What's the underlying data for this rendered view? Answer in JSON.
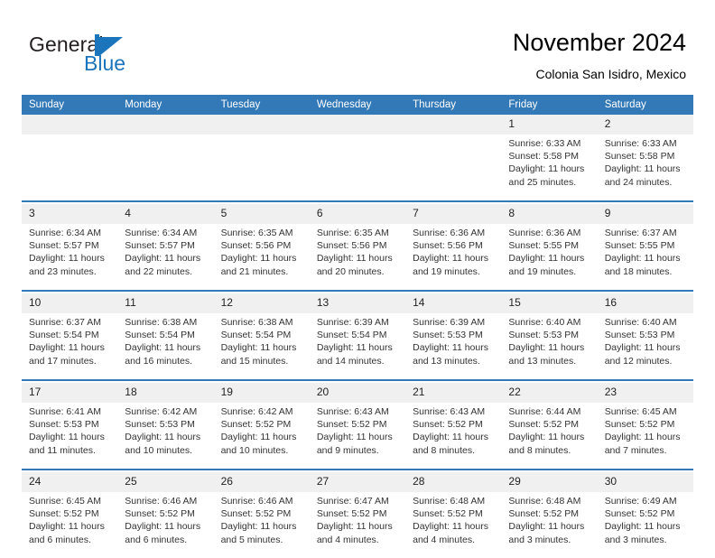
{
  "brand": {
    "word_one": "General",
    "word_two": "Blue",
    "mark": "triangle-logo"
  },
  "header": {
    "title": "November 2024",
    "location": "Colonia San Isidro, Mexico"
  },
  "colors": {
    "header_blue": "#3479b7",
    "brand_blue": "#1b75bc",
    "daynum_band": "#f0f0f0",
    "text": "#333333"
  },
  "weekday_headers": [
    "Sunday",
    "Monday",
    "Tuesday",
    "Wednesday",
    "Thursday",
    "Friday",
    "Saturday"
  ],
  "weeks": [
    [
      {
        "day": "",
        "sunrise": "",
        "sunset": "",
        "daylight_1": "",
        "daylight_2": ""
      },
      {
        "day": "",
        "sunrise": "",
        "sunset": "",
        "daylight_1": "",
        "daylight_2": ""
      },
      {
        "day": "",
        "sunrise": "",
        "sunset": "",
        "daylight_1": "",
        "daylight_2": ""
      },
      {
        "day": "",
        "sunrise": "",
        "sunset": "",
        "daylight_1": "",
        "daylight_2": ""
      },
      {
        "day": "",
        "sunrise": "",
        "sunset": "",
        "daylight_1": "",
        "daylight_2": ""
      },
      {
        "day": "1",
        "sunrise": "Sunrise: 6:33 AM",
        "sunset": "Sunset: 5:58 PM",
        "daylight_1": "Daylight: 11 hours",
        "daylight_2": "and 25 minutes."
      },
      {
        "day": "2",
        "sunrise": "Sunrise: 6:33 AM",
        "sunset": "Sunset: 5:58 PM",
        "daylight_1": "Daylight: 11 hours",
        "daylight_2": "and 24 minutes."
      }
    ],
    [
      {
        "day": "3",
        "sunrise": "Sunrise: 6:34 AM",
        "sunset": "Sunset: 5:57 PM",
        "daylight_1": "Daylight: 11 hours",
        "daylight_2": "and 23 minutes."
      },
      {
        "day": "4",
        "sunrise": "Sunrise: 6:34 AM",
        "sunset": "Sunset: 5:57 PM",
        "daylight_1": "Daylight: 11 hours",
        "daylight_2": "and 22 minutes."
      },
      {
        "day": "5",
        "sunrise": "Sunrise: 6:35 AM",
        "sunset": "Sunset: 5:56 PM",
        "daylight_1": "Daylight: 11 hours",
        "daylight_2": "and 21 minutes."
      },
      {
        "day": "6",
        "sunrise": "Sunrise: 6:35 AM",
        "sunset": "Sunset: 5:56 PM",
        "daylight_1": "Daylight: 11 hours",
        "daylight_2": "and 20 minutes."
      },
      {
        "day": "7",
        "sunrise": "Sunrise: 6:36 AM",
        "sunset": "Sunset: 5:56 PM",
        "daylight_1": "Daylight: 11 hours",
        "daylight_2": "and 19 minutes."
      },
      {
        "day": "8",
        "sunrise": "Sunrise: 6:36 AM",
        "sunset": "Sunset: 5:55 PM",
        "daylight_1": "Daylight: 11 hours",
        "daylight_2": "and 19 minutes."
      },
      {
        "day": "9",
        "sunrise": "Sunrise: 6:37 AM",
        "sunset": "Sunset: 5:55 PM",
        "daylight_1": "Daylight: 11 hours",
        "daylight_2": "and 18 minutes."
      }
    ],
    [
      {
        "day": "10",
        "sunrise": "Sunrise: 6:37 AM",
        "sunset": "Sunset: 5:54 PM",
        "daylight_1": "Daylight: 11 hours",
        "daylight_2": "and 17 minutes."
      },
      {
        "day": "11",
        "sunrise": "Sunrise: 6:38 AM",
        "sunset": "Sunset: 5:54 PM",
        "daylight_1": "Daylight: 11 hours",
        "daylight_2": "and 16 minutes."
      },
      {
        "day": "12",
        "sunrise": "Sunrise: 6:38 AM",
        "sunset": "Sunset: 5:54 PM",
        "daylight_1": "Daylight: 11 hours",
        "daylight_2": "and 15 minutes."
      },
      {
        "day": "13",
        "sunrise": "Sunrise: 6:39 AM",
        "sunset": "Sunset: 5:54 PM",
        "daylight_1": "Daylight: 11 hours",
        "daylight_2": "and 14 minutes."
      },
      {
        "day": "14",
        "sunrise": "Sunrise: 6:39 AM",
        "sunset": "Sunset: 5:53 PM",
        "daylight_1": "Daylight: 11 hours",
        "daylight_2": "and 13 minutes."
      },
      {
        "day": "15",
        "sunrise": "Sunrise: 6:40 AM",
        "sunset": "Sunset: 5:53 PM",
        "daylight_1": "Daylight: 11 hours",
        "daylight_2": "and 13 minutes."
      },
      {
        "day": "16",
        "sunrise": "Sunrise: 6:40 AM",
        "sunset": "Sunset: 5:53 PM",
        "daylight_1": "Daylight: 11 hours",
        "daylight_2": "and 12 minutes."
      }
    ],
    [
      {
        "day": "17",
        "sunrise": "Sunrise: 6:41 AM",
        "sunset": "Sunset: 5:53 PM",
        "daylight_1": "Daylight: 11 hours",
        "daylight_2": "and 11 minutes."
      },
      {
        "day": "18",
        "sunrise": "Sunrise: 6:42 AM",
        "sunset": "Sunset: 5:53 PM",
        "daylight_1": "Daylight: 11 hours",
        "daylight_2": "and 10 minutes."
      },
      {
        "day": "19",
        "sunrise": "Sunrise: 6:42 AM",
        "sunset": "Sunset: 5:52 PM",
        "daylight_1": "Daylight: 11 hours",
        "daylight_2": "and 10 minutes."
      },
      {
        "day": "20",
        "sunrise": "Sunrise: 6:43 AM",
        "sunset": "Sunset: 5:52 PM",
        "daylight_1": "Daylight: 11 hours",
        "daylight_2": "and 9 minutes."
      },
      {
        "day": "21",
        "sunrise": "Sunrise: 6:43 AM",
        "sunset": "Sunset: 5:52 PM",
        "daylight_1": "Daylight: 11 hours",
        "daylight_2": "and 8 minutes."
      },
      {
        "day": "22",
        "sunrise": "Sunrise: 6:44 AM",
        "sunset": "Sunset: 5:52 PM",
        "daylight_1": "Daylight: 11 hours",
        "daylight_2": "and 8 minutes."
      },
      {
        "day": "23",
        "sunrise": "Sunrise: 6:45 AM",
        "sunset": "Sunset: 5:52 PM",
        "daylight_1": "Daylight: 11 hours",
        "daylight_2": "and 7 minutes."
      }
    ],
    [
      {
        "day": "24",
        "sunrise": "Sunrise: 6:45 AM",
        "sunset": "Sunset: 5:52 PM",
        "daylight_1": "Daylight: 11 hours",
        "daylight_2": "and 6 minutes."
      },
      {
        "day": "25",
        "sunrise": "Sunrise: 6:46 AM",
        "sunset": "Sunset: 5:52 PM",
        "daylight_1": "Daylight: 11 hours",
        "daylight_2": "and 6 minutes."
      },
      {
        "day": "26",
        "sunrise": "Sunrise: 6:46 AM",
        "sunset": "Sunset: 5:52 PM",
        "daylight_1": "Daylight: 11 hours",
        "daylight_2": "and 5 minutes."
      },
      {
        "day": "27",
        "sunrise": "Sunrise: 6:47 AM",
        "sunset": "Sunset: 5:52 PM",
        "daylight_1": "Daylight: 11 hours",
        "daylight_2": "and 4 minutes."
      },
      {
        "day": "28",
        "sunrise": "Sunrise: 6:48 AM",
        "sunset": "Sunset: 5:52 PM",
        "daylight_1": "Daylight: 11 hours",
        "daylight_2": "and 4 minutes."
      },
      {
        "day": "29",
        "sunrise": "Sunrise: 6:48 AM",
        "sunset": "Sunset: 5:52 PM",
        "daylight_1": "Daylight: 11 hours",
        "daylight_2": "and 3 minutes."
      },
      {
        "day": "30",
        "sunrise": "Sunrise: 6:49 AM",
        "sunset": "Sunset: 5:52 PM",
        "daylight_1": "Daylight: 11 hours",
        "daylight_2": "and 3 minutes."
      }
    ]
  ]
}
